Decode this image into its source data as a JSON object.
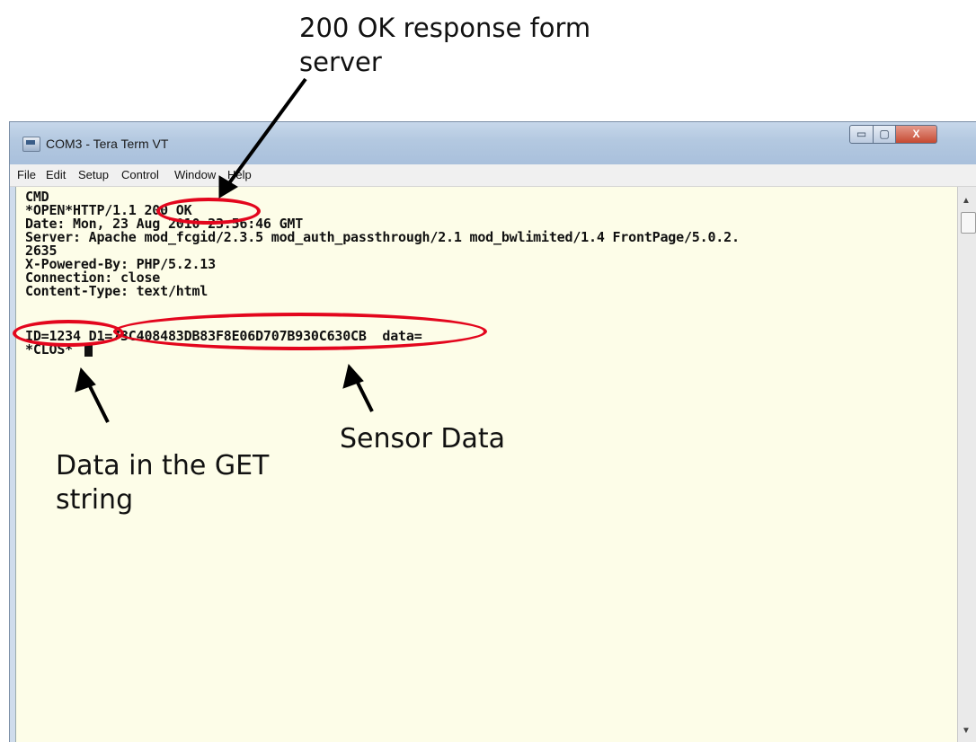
{
  "annotations": {
    "top_line1": "200 OK response form",
    "top_line2": "server",
    "sensor": "Sensor Data",
    "get_line1": "Data in the GET",
    "get_line2": "string"
  },
  "window": {
    "title": "COM3 - Tera Term VT",
    "controls": {
      "minimize": "▭",
      "maximize": "▢",
      "close": "X"
    }
  },
  "menu": [
    "File",
    "Edit",
    "Setup",
    "Control",
    "Window",
    "Help"
  ],
  "terminal": {
    "lines": [
      "CMD",
      "*OPEN*HTTP/1.1 200 OK",
      "Date: Mon, 23 Aug 2010 23:56:46 GMT",
      "Server: Apache mod_fcgid/2.3.5 mod_auth_passthrough/2.1 mod_bwlimited/1.4 FrontPage/5.0.2.",
      "2635",
      "X-Powered-By: PHP/5.2.13",
      "Connection: close",
      "Content-Type: text/html",
      "",
      "ID=1234 D1=73C408483DB83F8E06D707B930C630CB  data=",
      "*CLOS*"
    ]
  },
  "colors": {
    "annotation": "#e3061d",
    "terminal_bg": "#fdfde8"
  }
}
